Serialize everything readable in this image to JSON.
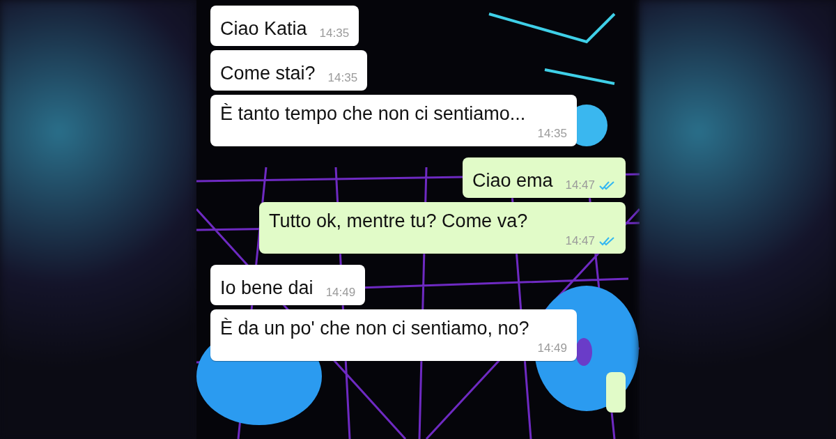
{
  "messages": [
    {
      "kind": "in",
      "text": "Ciao Katia",
      "time": "14:35"
    },
    {
      "kind": "in",
      "text": "Come stai?",
      "time": "14:35"
    },
    {
      "kind": "in",
      "text": "È tanto tempo che non ci sentiamo...",
      "time": "14:35"
    },
    {
      "kind": "out",
      "text": "Ciao ema",
      "time": "14:47",
      "read": true
    },
    {
      "kind": "out",
      "text": "Tutto ok, mentre tu? Come va?",
      "time": "14:47",
      "read": true
    },
    {
      "kind": "in",
      "text": "Io bene dai",
      "time": "14:49"
    },
    {
      "kind": "in",
      "text": "È da un po' che non ci sentiamo, no?",
      "time": "14:49"
    },
    {
      "kind": "out"
    }
  ]
}
